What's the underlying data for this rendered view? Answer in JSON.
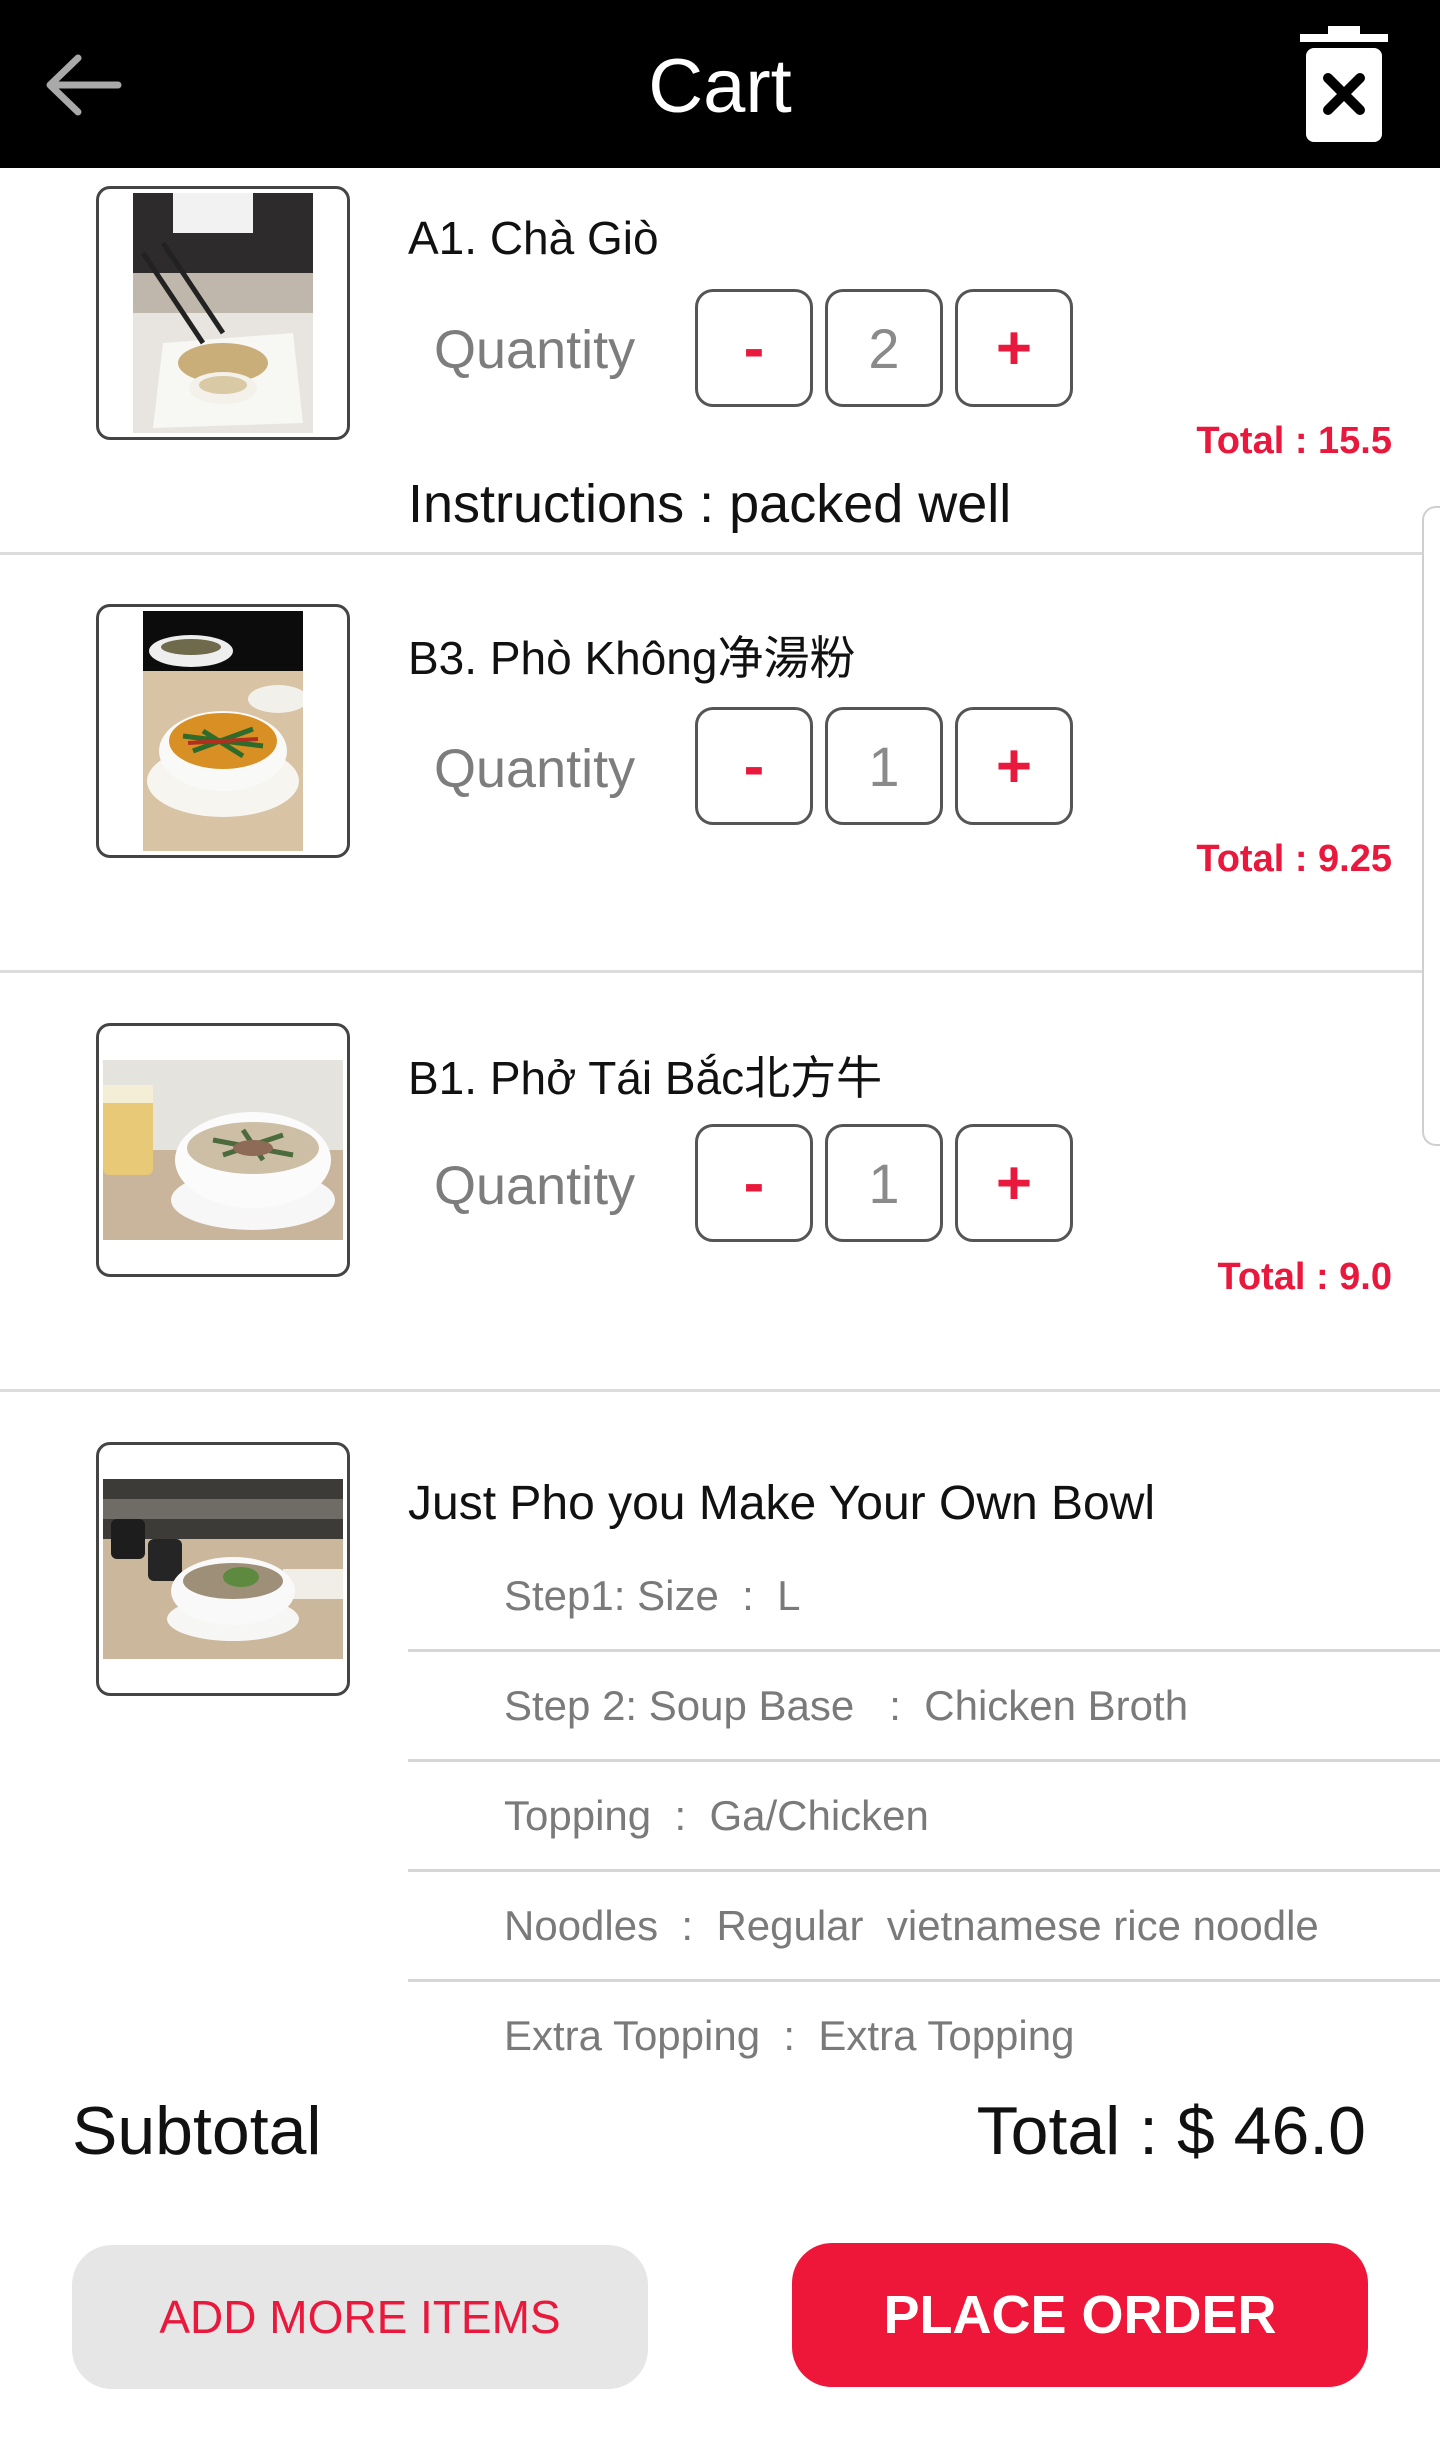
{
  "colors": {
    "accent": "#ee1639",
    "topbar": "#000000",
    "muted_text": "#7d7d7d"
  },
  "header": {
    "title": "Cart",
    "back_icon": "arrow-left-icon",
    "clear_icon": "trash-x-icon"
  },
  "cart_items": [
    {
      "name": "A1. Chà Giò",
      "quantity_label": "Quantity",
      "quantity": "2",
      "minus": "-",
      "plus": "+",
      "total": "Total : 15.5",
      "instructions": "Instructions : packed well"
    },
    {
      "name": "B3. Phò Không净湯粉",
      "quantity_label": "Quantity",
      "quantity": "1",
      "minus": "-",
      "plus": "+",
      "total": "Total : 9.25"
    },
    {
      "name": "B1. Phở Tái Bắc北方牛",
      "quantity_label": "Quantity",
      "quantity": "1",
      "minus": "-",
      "plus": "+",
      "total": "Total : 9.0"
    }
  ],
  "custom_bowl": {
    "name": "Just Pho you Make Your Own Bowl",
    "options": [
      "Step1: Size  :  L",
      "Step 2: Soup Base   :  Chicken Broth",
      "Topping  :  Ga/Chicken",
      "Noodles  :  Regular  vietnamese rice noodle",
      "Extra Topping  :  Extra Topping"
    ]
  },
  "footer": {
    "subtotal_label": "Subtotal",
    "total": "Total : $ 46.0",
    "add_more": "ADD MORE ITEMS",
    "place_order": "PLACE ORDER"
  }
}
